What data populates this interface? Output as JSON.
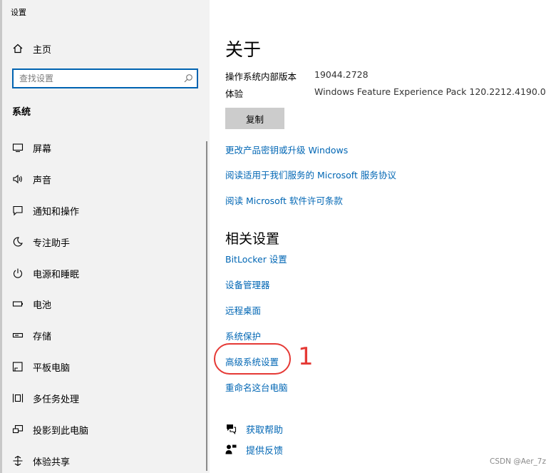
{
  "window": {
    "title": "设置"
  },
  "sidebar": {
    "home_label": "主页",
    "search_placeholder": "查找设置",
    "section_label": "系统",
    "items": [
      {
        "label": "屏幕",
        "icon": "monitor-icon"
      },
      {
        "label": "声音",
        "icon": "speaker-icon"
      },
      {
        "label": "通知和操作",
        "icon": "notification-icon"
      },
      {
        "label": "专注助手",
        "icon": "moon-icon"
      },
      {
        "label": "电源和睡眠",
        "icon": "power-icon"
      },
      {
        "label": "电池",
        "icon": "battery-icon"
      },
      {
        "label": "存储",
        "icon": "storage-icon"
      },
      {
        "label": "平板电脑",
        "icon": "tablet-icon"
      },
      {
        "label": "多任务处理",
        "icon": "multitask-icon"
      },
      {
        "label": "投影到此电脑",
        "icon": "project-icon"
      },
      {
        "label": "体验共享",
        "icon": "share-icon"
      }
    ]
  },
  "main": {
    "title": "关于",
    "specs": [
      {
        "label": "操作系统内部版本",
        "value": "19044.2728"
      },
      {
        "label": "体验",
        "value": "Windows Feature Experience Pack 120.2212.4190.0"
      }
    ],
    "copy_button": "复制",
    "links": [
      "更改产品密钥或升级 Windows",
      "阅读适用于我们服务的 Microsoft 服务协议",
      "阅读 Microsoft 软件许可条款"
    ],
    "related_heading": "相关设置",
    "related_links": [
      "BitLocker 设置",
      "设备管理器",
      "远程桌面",
      "系统保护",
      "高级系统设置",
      "重命名这台电脑"
    ],
    "annotation": {
      "number": "1",
      "color": "#e53935"
    },
    "help": [
      {
        "label": "获取帮助",
        "icon": "help-icon"
      },
      {
        "label": "提供反馈",
        "icon": "feedback-icon"
      }
    ]
  },
  "watermark": "CSDN @Aer_7z",
  "colors": {
    "accent": "#0066b4",
    "search_border": "#0063b1",
    "button_bg": "#cccccc",
    "sidebar_bg": "#f2f2f2"
  }
}
